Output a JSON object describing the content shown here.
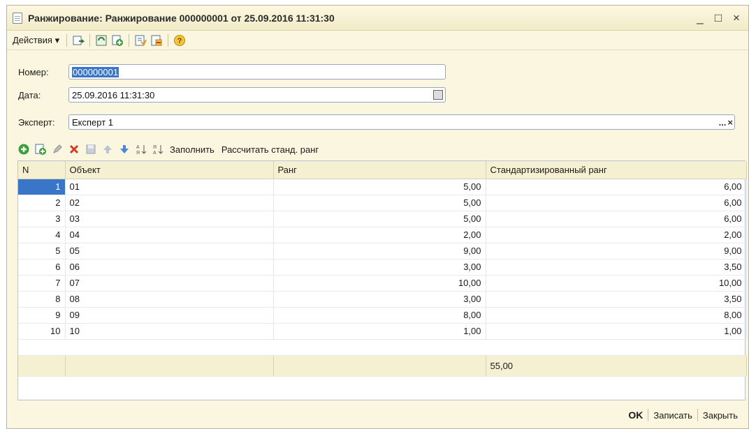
{
  "window": {
    "title": "Ранжирование: Ранжирование 000000001 от 25.09.2016 11:31:30",
    "minimize": "_",
    "maximize": "□",
    "close": "×"
  },
  "toolbar": {
    "actions_label": "Действия ▾"
  },
  "form": {
    "number_label": "Номер:",
    "number_value": "000000001",
    "date_label": "Дата:",
    "date_value": "25.09.2016 11:31:30",
    "expert_label": "Эксперт:",
    "expert_value": "Експерт 1",
    "expert_select": "...",
    "expert_clear": "×"
  },
  "table_toolbar": {
    "fill_label": "Заполнить",
    "calc_label": "Рассчитать станд. ранг"
  },
  "table": {
    "columns": [
      "N",
      "Объект",
      "Ранг",
      "Стандартизированный ранг"
    ],
    "rows": [
      [
        "1",
        "01",
        "5,00",
        "6,00"
      ],
      [
        "2",
        "02",
        "5,00",
        "6,00"
      ],
      [
        "3",
        "03",
        "5,00",
        "6,00"
      ],
      [
        "4",
        "04",
        "2,00",
        "2,00"
      ],
      [
        "5",
        "05",
        "9,00",
        "9,00"
      ],
      [
        "6",
        "06",
        "3,00",
        "3,50"
      ],
      [
        "7",
        "07",
        "10,00",
        "10,00"
      ],
      [
        "8",
        "08",
        "3,00",
        "3,50"
      ],
      [
        "9",
        "09",
        "8,00",
        "8,00"
      ],
      [
        "10",
        "10",
        "1,00",
        "1,00"
      ]
    ],
    "footer_total": "55,00"
  },
  "bottom": {
    "ok_label": "OK",
    "save_label": "Записать",
    "close_label": "Закрыть"
  },
  "colors": {
    "accent": "#3a76c8",
    "window_bg": "#fbf6df",
    "header_bg": "#f6f0d2"
  }
}
